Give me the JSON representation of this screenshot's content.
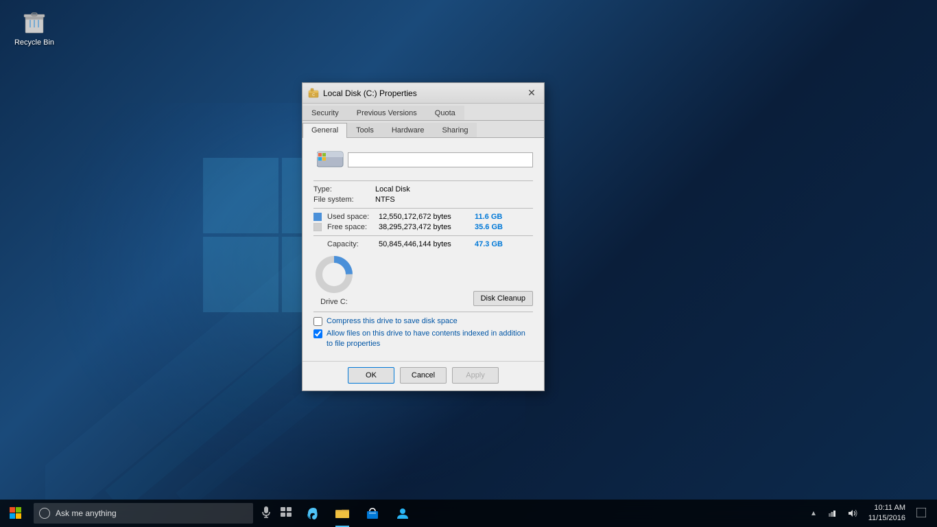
{
  "desktop": {
    "background": "#1a3a5c"
  },
  "recycle_bin": {
    "label": "Recycle Bin"
  },
  "dialog": {
    "title": "Local Disk (C:) Properties",
    "tabs_row1": [
      {
        "id": "security",
        "label": "Security",
        "active": false
      },
      {
        "id": "previous_versions",
        "label": "Previous Versions",
        "active": false
      },
      {
        "id": "quota",
        "label": "Quota",
        "active": false
      }
    ],
    "tabs_row2": [
      {
        "id": "general",
        "label": "General",
        "active": true
      },
      {
        "id": "tools",
        "label": "Tools",
        "active": false
      },
      {
        "id": "hardware",
        "label": "Hardware",
        "active": false
      },
      {
        "id": "sharing",
        "label": "Sharing",
        "active": false
      }
    ],
    "drive_name": "",
    "type_label": "Type:",
    "type_value": "Local Disk",
    "filesystem_label": "File system:",
    "filesystem_value": "NTFS",
    "used_space_label": "Used space:",
    "used_space_bytes": "12,550,172,672 bytes",
    "used_space_gb": "11.6 GB",
    "free_space_label": "Free space:",
    "free_space_bytes": "38,295,273,472 bytes",
    "free_space_gb": "35.6 GB",
    "capacity_label": "Capacity:",
    "capacity_bytes": "50,845,446,144 bytes",
    "capacity_gb": "47.3 GB",
    "drive_label": "Drive C:",
    "disk_cleanup_btn": "Disk Cleanup",
    "compress_label": "Compress this drive to save disk space",
    "index_label": "Allow files on this drive to have contents indexed in addition to file properties",
    "ok_btn": "OK",
    "cancel_btn": "Cancel",
    "apply_btn": "Apply",
    "donut": {
      "used_pct": 24.7,
      "free_pct": 75.3,
      "used_color": "#4a90d9",
      "free_color": "#d0d0d0"
    }
  },
  "taskbar": {
    "search_placeholder": "Ask me anything",
    "time": "10:11 AM",
    "date": "11/15/2016"
  }
}
